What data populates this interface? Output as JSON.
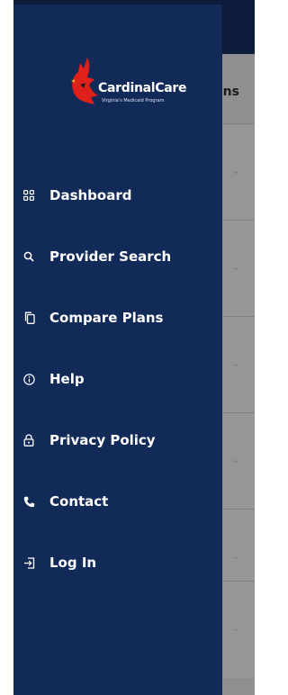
{
  "background": {
    "heading_partial": "ons"
  },
  "logo": {
    "name": "CardinalCare",
    "tagline": "Virginia's Medicaid Program",
    "colors": {
      "bird": "#e0201b",
      "text": "#ffffff"
    }
  },
  "menu": {
    "items": [
      {
        "label": "Dashboard",
        "icon": "dashboard-grid-icon"
      },
      {
        "label": "Provider Search",
        "icon": "search-icon"
      },
      {
        "label": "Compare Plans",
        "icon": "copy-icon"
      },
      {
        "label": "Help",
        "icon": "info-icon"
      },
      {
        "label": "Privacy Policy",
        "icon": "lock-icon"
      },
      {
        "label": "Contact",
        "icon": "phone-icon"
      },
      {
        "label": "Log In",
        "icon": "login-icon"
      }
    ]
  },
  "colors": {
    "drawer_bg": "#122a58",
    "topbar_bg": "#0e1c3c",
    "overlay": "#8f8f8f"
  }
}
